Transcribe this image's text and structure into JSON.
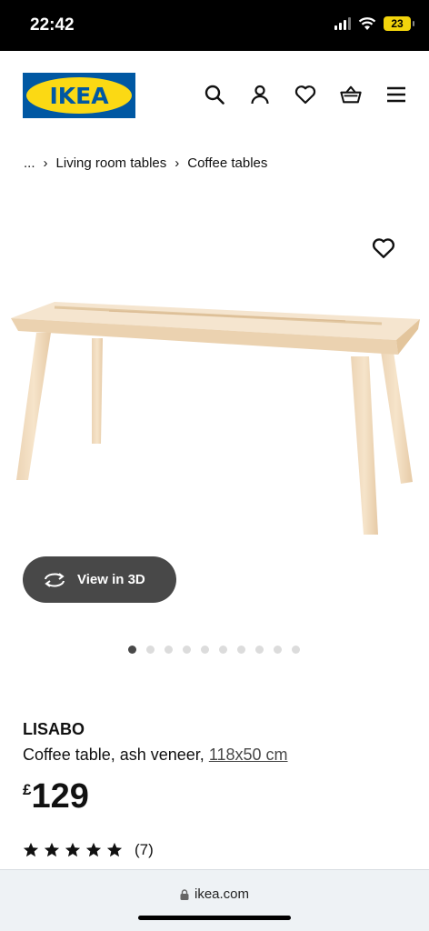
{
  "status_bar": {
    "time": "22:42",
    "battery": "23"
  },
  "header": {
    "logo_text": "IKEA",
    "icons": [
      "search-icon",
      "account-icon",
      "heart-icon",
      "basket-icon",
      "menu-icon"
    ]
  },
  "breadcrumb": {
    "ellipsis": "...",
    "items": [
      "Living room tables",
      "Coffee tables"
    ]
  },
  "product": {
    "view_3d_label": "View in 3D",
    "carousel": {
      "total": 10,
      "active": 1
    },
    "name": "LISABO",
    "description": "Coffee table, ash veneer, ",
    "size": "118x50 cm",
    "currency": "£",
    "price": "129",
    "rating": {
      "stars": 5,
      "count": "(7)"
    }
  },
  "browser": {
    "url": "ikea.com"
  },
  "colors": {
    "brand_blue": "#0058a3",
    "brand_yellow": "#fbd914",
    "button_dark": "#484848"
  }
}
